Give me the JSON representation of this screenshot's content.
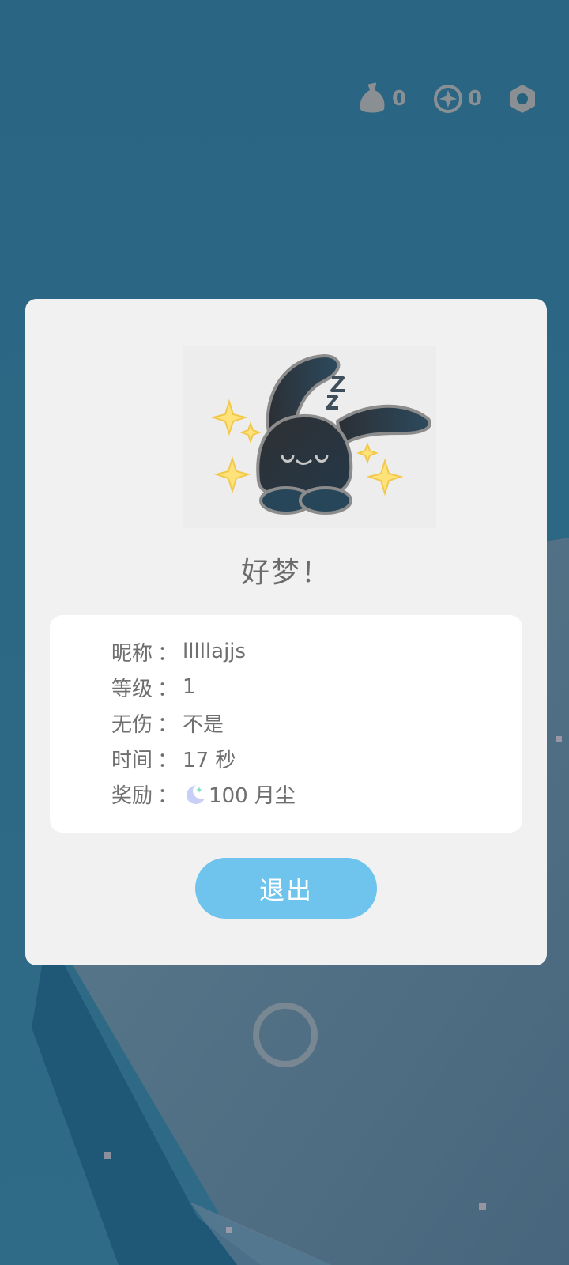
{
  "hud": {
    "bag_count": "0",
    "coin_count": "0",
    "icons": [
      "bag-icon",
      "coin-icon",
      "settings-icon"
    ]
  },
  "dialog": {
    "title": "好梦！",
    "info": {
      "nickname_label": "昵称",
      "nickname_value": "lllllajjs",
      "level_label": "等级",
      "level_value": "1",
      "no_damage_label": "无伤",
      "no_damage_value": "不是",
      "time_label": "时间",
      "time_value": "17 秒",
      "reward_label": "奖励",
      "reward_value": "100 月尘",
      "separator": "："
    },
    "exit_label": "退出"
  },
  "colors": {
    "background": "#27627d",
    "dialog": "#f1f1f1",
    "button": "#6ec4ec",
    "text": "#6f6f6f"
  }
}
